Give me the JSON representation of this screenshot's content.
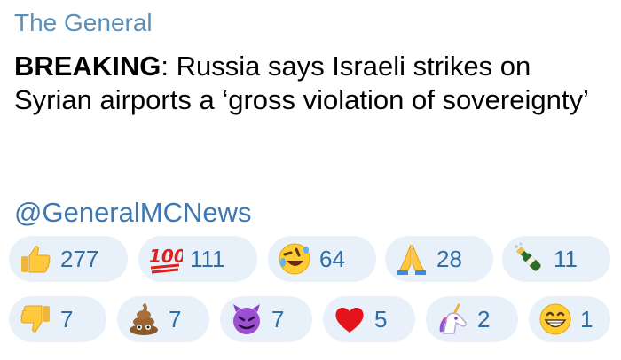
{
  "channel": {
    "name": "The General"
  },
  "message": {
    "prefix": "BREAKING",
    "separator": ":",
    "body": " Russia says Israeli strikes on Syrian airports a ‘gross violation of sovereignty’",
    "handle": "@GeneralMCNews"
  },
  "reactions": {
    "row1": [
      {
        "icon": "thumbs-up",
        "count": "277"
      },
      {
        "icon": "hundred-points",
        "count": "111"
      },
      {
        "icon": "rolling-laughing",
        "count": "64"
      },
      {
        "icon": "folded-hands",
        "count": "28"
      },
      {
        "icon": "champagne-bottle",
        "count": "11"
      }
    ],
    "row2": [
      {
        "icon": "thumbs-down",
        "count": "7"
      },
      {
        "icon": "pile-of-poo",
        "count": "7"
      },
      {
        "icon": "smiling-devil",
        "count": "7"
      },
      {
        "icon": "red-heart",
        "count": "5"
      },
      {
        "icon": "unicorn",
        "count": "2"
      },
      {
        "icon": "grinning-face",
        "count": "1"
      }
    ]
  },
  "colors": {
    "channel_name": "#5b8fb9",
    "handle_link": "#3b78b4",
    "reaction_bg": "#e8f1fa",
    "reaction_count": "#2f6ea6"
  }
}
